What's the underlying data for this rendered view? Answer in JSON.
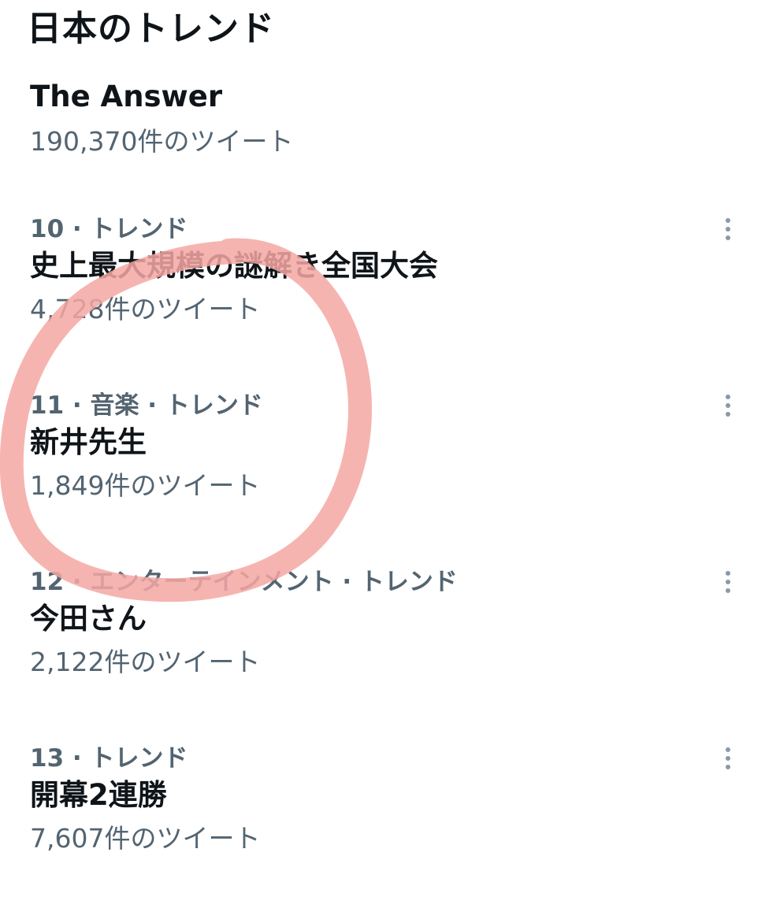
{
  "page": {
    "title": "日本のトレンド"
  },
  "trends": [
    {
      "meta": "",
      "name": "The Answer",
      "count": "190,370件のツイート"
    },
    {
      "meta": "10 · トレンド",
      "name": "史上最大規模の謎解き全国大会",
      "count": "4,728件のツイート"
    },
    {
      "meta": "11 · 音楽 · トレンド",
      "name": "新井先生",
      "count": "1,849件のツイート"
    },
    {
      "meta": "12 · エンターテインメント · トレンド",
      "name": "今田さん",
      "count": "2,122件のツイート"
    },
    {
      "meta": "13 · トレンド",
      "name": "開幕2連勝",
      "count": "7,607件のツイート"
    }
  ],
  "colors": {
    "text_primary": "#0f1419",
    "text_secondary": "#536471",
    "more_icon": "#8b98a5",
    "annotation_circle": "#f4a7a3"
  },
  "icons": {
    "more": "more-vertical-icon"
  }
}
